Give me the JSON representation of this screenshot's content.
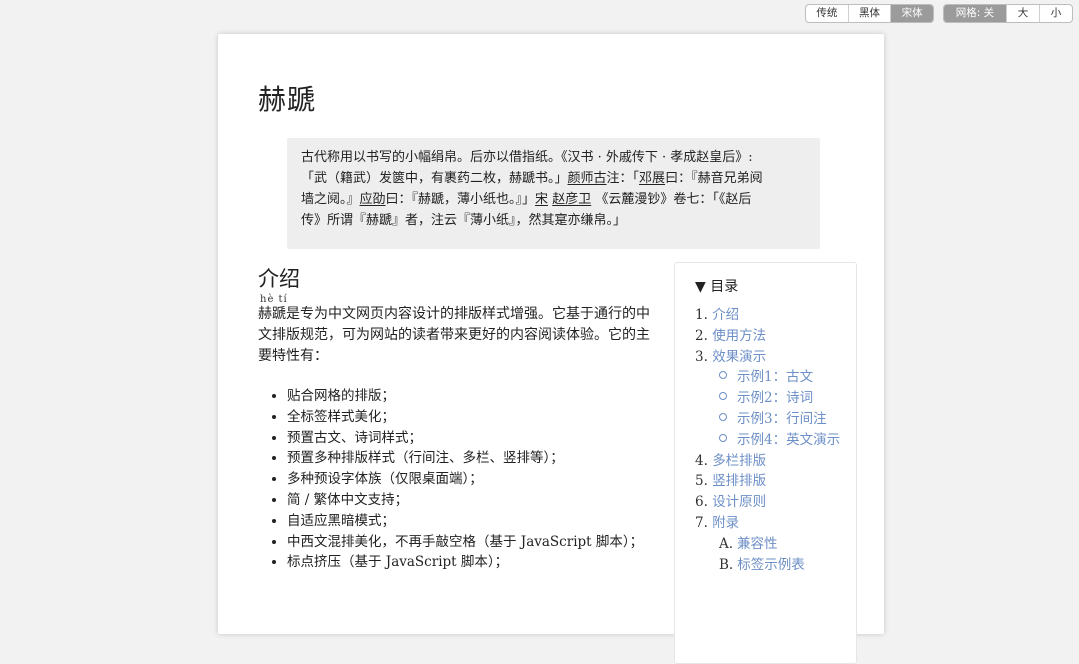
{
  "toolbar": {
    "font_buttons": [
      "传统",
      "黑体",
      "宋体"
    ],
    "font_selected": "宋体",
    "grid_label": "网格: 关",
    "grid_large": "大",
    "grid_small": "小"
  },
  "article": {
    "title": "赫蹏",
    "quote": {
      "line1": "古代称用以书写的小幅绢帛。后亦以借指纸。《汉书 · 外戚传下 · 孝成赵皇后》:",
      "line2_a": "「武（籍武）发篋中，有裹药二枚，赫蹏书。」",
      "line2_name1": "颜师古",
      "line2_b": "注：「",
      "line2_name2": "邓展",
      "line2_c": "曰：『赫音兄弟阋",
      "line3_a": "墙之阋。』",
      "line3_name1": "应劭",
      "line3_b": "曰：『赫蹏，薄小纸也。』」",
      "line3_name2": "宋",
      "line3_name3": "赵彦卫",
      "line3_c": "《云麓漫钞》卷七：「《赵后",
      "line4": "传》所谓『赫蹏』者，注云『薄小纸』，然其寔亦缣帛。」"
    },
    "section_title": "介绍",
    "ruby": "hè tí",
    "intro": "赫蹏是专为中文网页内容设计的排版样式增强。它基于通行的中文排版规范，可为网站的读者带来更好的内容阅读体验。它的主要特性有：",
    "features": [
      "贴合网格的排版；",
      "全标签样式美化；",
      "预置古文、诗词样式；",
      "预置多种排版样式（行间注、多栏、竖排等）；",
      "多种预设字体族（仅限桌面端）；",
      "简 / 繁体中文支持；",
      "自适应黑暗模式；",
      "中西文混排美化，不再手敲空格（基于 JavaScript 脚本）；",
      "标点挤压（基于 JavaScript 脚本）；"
    ]
  },
  "toc": {
    "heading": "▼ 目录",
    "items": [
      {
        "num": "1.",
        "label": "介绍"
      },
      {
        "num": "2.",
        "label": "使用方法"
      },
      {
        "num": "3.",
        "label": "效果演示"
      },
      {
        "num": "4.",
        "label": "多栏排版"
      },
      {
        "num": "5.",
        "label": "竖排排版"
      },
      {
        "num": "6.",
        "label": "设计原则"
      },
      {
        "num": "7.",
        "label": "附录"
      }
    ],
    "sub3": [
      "示例1：古文",
      "示例2：诗词",
      "示例3：行间注",
      "示例4：英文演示"
    ],
    "sub7": [
      {
        "num": "A.",
        "label": "兼容性"
      },
      {
        "num": "B.",
        "label": "标签示例表"
      }
    ]
  },
  "colors": {
    "link": "#6d8fc7",
    "selected_button": "#9b9b9b",
    "background": "#f2f2f2"
  }
}
